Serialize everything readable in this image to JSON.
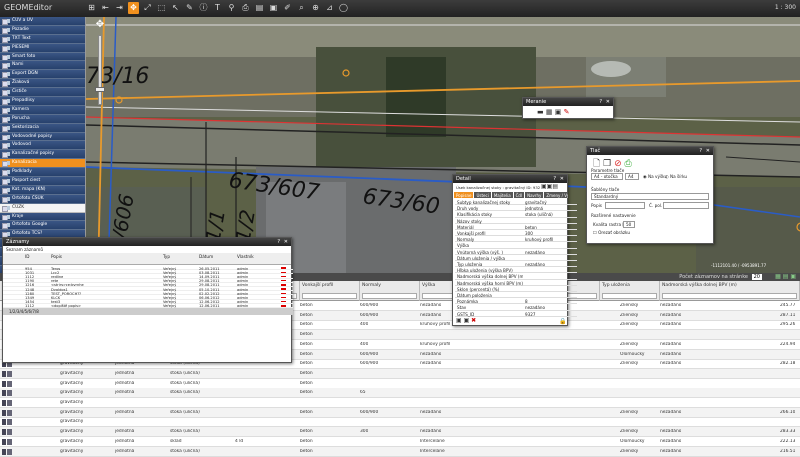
{
  "app": {
    "title": "GEOMEditor",
    "scale": "1 : 300"
  },
  "toolbar": {
    "active_index": 3,
    "icons": [
      "pan-icon",
      "rewind-icon",
      "forward-icon",
      "move-icon",
      "fullscreen-icon",
      "select-rect-icon",
      "pointer-icon",
      "edit-icon",
      "info-icon",
      "text-icon",
      "pin-icon",
      "print-icon",
      "layers-icon",
      "save-icon",
      "pencil-icon",
      "search-icon",
      "zoom-icon",
      "ruler-icon",
      "circle-icon"
    ]
  },
  "layers": [
    {
      "label": "ČÚV a ÚV",
      "state": "normal"
    },
    {
      "label": "Pozadie",
      "state": "normal"
    },
    {
      "label": "TXT Text",
      "state": "normal"
    },
    {
      "label": "PIESEMI",
      "state": "normal"
    },
    {
      "label": "Smart foto",
      "state": "normal"
    },
    {
      "label": "Nami",
      "state": "normal"
    },
    {
      "label": "Export DGN",
      "state": "normal"
    },
    {
      "label": "Žiaková",
      "state": "normal"
    },
    {
      "label": "Čističe",
      "state": "normal"
    },
    {
      "label": "Prepadlisy",
      "state": "normal"
    },
    {
      "label": "Kamera",
      "state": "normal"
    },
    {
      "label": "Porucha",
      "state": "normal"
    },
    {
      "label": "Sektorizacia",
      "state": "normal"
    },
    {
      "label": "Vodovodné popisy",
      "state": "normal"
    },
    {
      "label": "Vodovod",
      "state": "normal"
    },
    {
      "label": "Kanalizačné popisy",
      "state": "normal"
    },
    {
      "label": "Kanalizacia",
      "state": "sel"
    },
    {
      "label": "Podklady",
      "state": "normal"
    },
    {
      "label": "Pasport ciest",
      "state": "normal"
    },
    {
      "label": "Kat. mapa (KN)",
      "state": "normal"
    },
    {
      "label": "Ortofoto ČSÚK",
      "state": "normal"
    },
    {
      "label": "ČÚZK",
      "state": "white"
    },
    {
      "label": "Kraje",
      "state": "normal"
    },
    {
      "label": "Ortofoto Google",
      "state": "normal"
    },
    {
      "label": "Ortofoto TCS?",
      "state": "normal"
    },
    {
      "label": "Geologická mapa",
      "state": "normal"
    },
    {
      "label": "ŽP: Povodňové",
      "state": "normal"
    },
    {
      "label": "Vodovod SVK",
      "state": "normal"
    },
    {
      "label": "OSM",
      "state": "normal"
    }
  ],
  "map_labels": {
    "p1": "73/16",
    "p2": "673/607",
    "p3": "673/60",
    "p4": "3/606",
    "p5": "1/1",
    "p6": "1/2",
    "scale_text": "-1112101.40 / -0953891.77"
  },
  "meranie_panel": {
    "title": "Meranie"
  },
  "tlac_panel": {
    "title": "Tlač",
    "section_params": "Parametre tlače",
    "select_a4": "A4 - otočka",
    "select_zoom": "A4",
    "orient_na_sirku": "Na výšku",
    "orient_na_dlzku": "Na šírku",
    "section_template": "Šablóny tlače",
    "template_value": "Štandardný",
    "field_popis": "Popis",
    "field_c_pol": "Č. pol.",
    "section_adv": "Rozšírené nastavenie",
    "field_kvalita": "Kvalita rastra [%]",
    "kvalita_value": "50",
    "chk_label": "Orezať obrázku"
  },
  "detail_panel": {
    "title": "Detail",
    "subtitle": "Úsek kanalizačnej stoky : gravitačný ID: 9327",
    "tabs": [
      "Popisne",
      "Ústeci",
      "Majitelia",
      "Čdl",
      "Navrhy",
      "Zmeny / Vyzdy"
    ],
    "rows": [
      [
        "Subtyp kanalizačnej stoky",
        "gravitačný"
      ],
      [
        "Druh vody",
        "jednotná"
      ],
      [
        "Klasifikácia stoky",
        "stoka (uličná)"
      ],
      [
        "Názov stoky",
        ""
      ],
      [
        "Materiál",
        "beton"
      ],
      [
        "Vonkajší profil",
        "300"
      ],
      [
        "Normaly",
        "kruhový profil"
      ],
      [
        "Výška",
        ""
      ],
      [
        "Vnútorná výška (výš. )",
        "nezadáno"
      ],
      [
        "Dátum uloženia / výška",
        ""
      ],
      [
        "Typ uloženia",
        "nezadáno"
      ],
      [
        "Hĺbka uloženia (výška BPV)",
        ""
      ],
      [
        "Nadmorská výška dolnej BPV (m)",
        ""
      ],
      [
        "Nadmorská výška horní BPV (m)",
        ""
      ],
      [
        "Sklon (percentá) (%)",
        ""
      ],
      [
        "Dátum položenia",
        ""
      ],
      [
        "Poznámka",
        "8"
      ],
      [
        "Stav",
        "nezadáno"
      ],
      [
        "GSTS_ID",
        "9327"
      ]
    ]
  },
  "zaznamy_panel": {
    "title": "Záznamy",
    "subtitle": "Seznam záznamů",
    "columns": [
      "ID",
      "Popis",
      "Typ",
      "Dátum",
      "Vlastník"
    ],
    "rows": [
      [
        "954",
        "Teros",
        "Veřejný",
        "26.05.2011",
        "admin"
      ],
      [
        "1031",
        "Lcc2",
        "Veřejný",
        "03.08.2011",
        "admin"
      ],
      [
        "1112",
        "redline",
        "Veřejný",
        "14.09.2011",
        "admin"
      ],
      [
        "1190",
        "rete",
        "Veřejný",
        "29.08.2011",
        "admin"
      ],
      [
        "1216",
        "<strirs:rce:bvrnhe",
        "Veřejný",
        "29.08.2011",
        "admin"
      ],
      [
        "1248",
        "Dvaldos1",
        "Veřejný",
        "05.10.2011",
        "admin"
      ],
      [
        "1280",
        "TEST_POROCH??",
        "Veřejný",
        "02.02.2012",
        "admin"
      ],
      [
        "1349",
        "KLCK",
        "Veřejný",
        "06.06.2012",
        "admin"
      ],
      [
        "1454",
        "test3",
        "Veřejný",
        "12.06.2012",
        "admin"
      ],
      [
        "1112",
        "<dopiště popis>",
        "Veřejný",
        "12.06.2011",
        "admin"
      ]
    ],
    "pager": "1/2/3/4/5/6/7/8"
  },
  "grid": {
    "header_text": "Počet záznamov na stránke",
    "page_size": "20",
    "columns": [
      "Materiál",
      "Vonkajší profil",
      "Normaly",
      "Výška",
      "Vnút. výška",
      "Typ",
      "Typ uloženia",
      "Nadmorská výška dolnej BPV (m)"
    ],
    "rows": [
      [
        "gravitačný",
        "jednotná",
        "stoka (uličná)",
        "",
        "beton",
        "600/900",
        "nezadáno",
        "Zlienský",
        "nezadáno",
        "245.77"
      ],
      [
        "gravitačný",
        "jednotná",
        "stoka (uličná)",
        "",
        "beton",
        "600/900",
        "nezadáno",
        "Zlienský",
        "nezadáno",
        "287.11"
      ],
      [
        "gravitačný",
        "jednotná",
        "stoka (uličná)",
        "",
        "beton",
        "400",
        "kruhový profil",
        "Zlienský",
        "nezadáno",
        "295.26"
      ],
      [
        "gravitačný",
        "jednotná",
        "stoka (uličná)",
        "",
        "beton",
        "",
        "",
        "",
        "",
        ""
      ],
      [
        "gravitačný",
        "jednotná",
        "stoka (uličná)",
        "",
        "beton",
        "400",
        "kruhový profil",
        "Zlienský",
        "nezadáno",
        "224.94"
      ],
      [
        "gravitačný",
        "jednotná",
        "stoka (uličná)",
        "",
        "beton",
        "600/900",
        "nezadáno",
        "Olomoucký",
        "nezadáno",
        ""
      ],
      [
        "gravitačný",
        "jednotná",
        "stoka (uličná)",
        "",
        "beton",
        "600/900",
        "nezadáno",
        "Zlienský",
        "nezadáno",
        "282.18"
      ],
      [
        "gravitačný",
        "jednotná",
        "stoka (uličná)",
        "",
        "beton",
        "",
        "",
        "",
        "",
        ""
      ],
      [
        "gravitačný",
        "jednotná",
        "stoka (uličná)",
        "",
        "beton",
        "",
        "",
        "",
        "",
        ""
      ],
      [
        "gravitačný",
        "jednotná",
        "stoka (uličná)",
        "",
        "beton",
        "65",
        "",
        "",
        "",
        ""
      ],
      [
        "gravitačný",
        "",
        "",
        "",
        "",
        "",
        "",
        "",
        "",
        ""
      ],
      [
        "gravitačný",
        "jednotná",
        "stoka (uličná)",
        "",
        "beton",
        "600/900",
        "nezadáno",
        "Zlienský",
        "nezadáno",
        "266.10"
      ],
      [
        "gravitačný",
        "",
        "",
        "",
        "",
        "",
        "",
        "",
        "",
        ""
      ],
      [
        "gravitačný",
        "jednotná",
        "stoka (uličná)",
        "",
        "beton",
        "300",
        "nezadáno",
        "Zlienský",
        "nezadáno",
        "283.33"
      ],
      [
        "gravitačný",
        "jednotná",
        "sklad",
        "4 ld",
        "beton",
        "",
        "Intercelane",
        "Olomoucký",
        "nezadáno",
        "222.13"
      ],
      [
        "gravitačný",
        "jednotná",
        "stoka (uličná)",
        "",
        "beton",
        "",
        "Intercelane",
        "Zlienský",
        "nezadáno",
        "216.51"
      ]
    ]
  }
}
